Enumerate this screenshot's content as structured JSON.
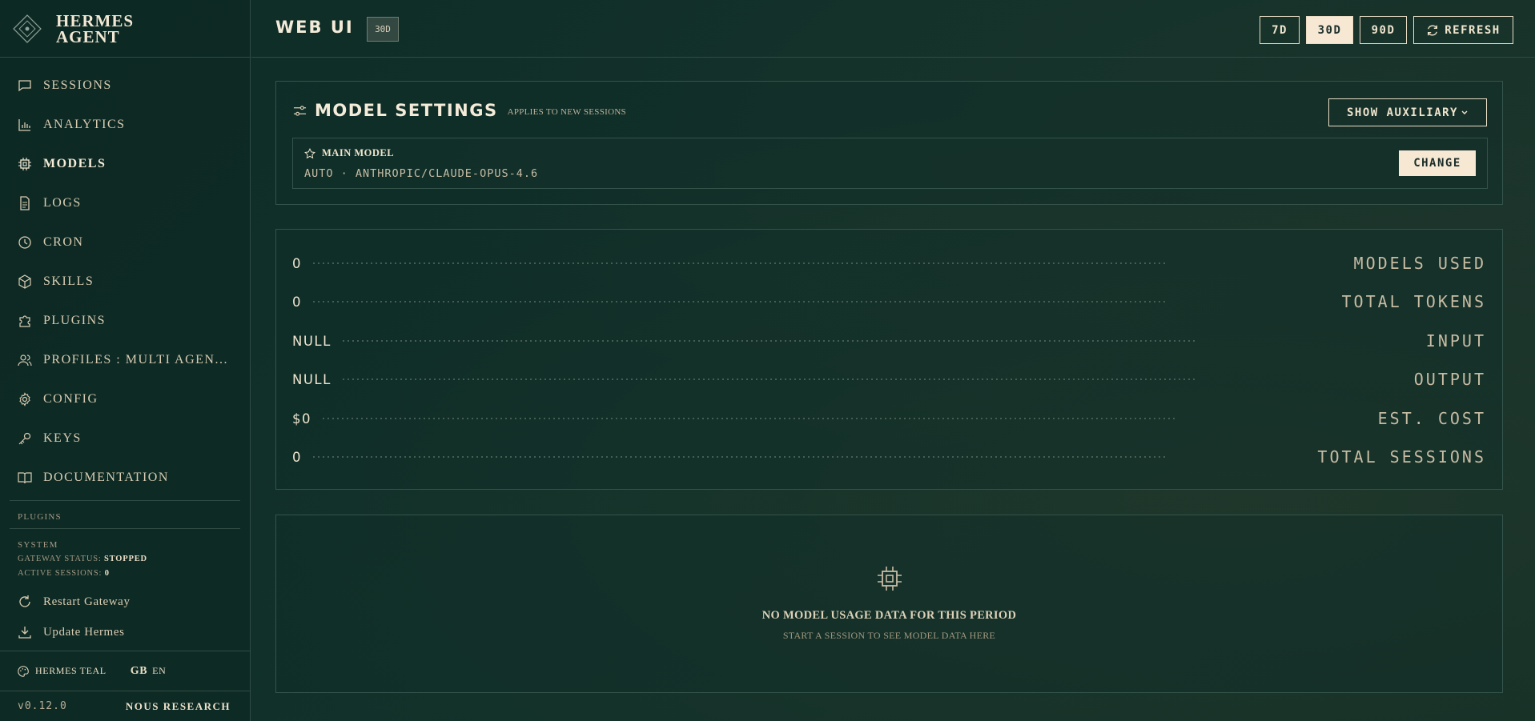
{
  "brand": {
    "line1": "HERMES",
    "line2": "AGENT"
  },
  "sidebar": {
    "items": [
      {
        "label": "SESSIONS",
        "icon": "chat-icon"
      },
      {
        "label": "ANALYTICS",
        "icon": "bar-chart-icon"
      },
      {
        "label": "MODELS",
        "icon": "cpu-icon",
        "active": true
      },
      {
        "label": "LOGS",
        "icon": "file-icon"
      },
      {
        "label": "CRON",
        "icon": "clock-icon"
      },
      {
        "label": "SKILLS",
        "icon": "cube-icon"
      },
      {
        "label": "PLUGINS",
        "icon": "puzzle-icon"
      },
      {
        "label": "PROFILES : MULTI AGEN...",
        "icon": "users-icon"
      },
      {
        "label": "CONFIG",
        "icon": "gear-icon"
      },
      {
        "label": "KEYS",
        "icon": "key-icon"
      },
      {
        "label": "DOCUMENTATION",
        "icon": "book-icon"
      }
    ],
    "plugins_heading": "PLUGINS",
    "system_heading": "SYSTEM",
    "gateway_status_label": "GATEWAY STATUS:",
    "gateway_status_value": "STOPPED",
    "active_sessions_label": "ACTIVE SESSIONS:",
    "active_sessions_value": "0",
    "restart_label": "Restart Gateway",
    "update_label": "Update Hermes",
    "theme_label": "HERMES TEAL",
    "lang_flag": "GB",
    "lang_code": "EN",
    "version": "v0.12.0",
    "vendor": "NOUS RESEARCH"
  },
  "header": {
    "title": "WEB UI",
    "badge": "30D",
    "ranges": [
      {
        "label": "7D",
        "active": false
      },
      {
        "label": "30D",
        "active": true
      },
      {
        "label": "90D",
        "active": false
      }
    ],
    "refresh_label": "REFRESH"
  },
  "model_settings": {
    "title": "MODEL SETTINGS",
    "subtitle": "APPLIES TO NEW SESSIONS",
    "aux_button": "SHOW AUXILIARY",
    "main_model_label": "MAIN MODEL",
    "main_model_value": "AUTO · ANTHROPIC/CLAUDE-OPUS-4.6",
    "change_button": "CHANGE"
  },
  "stats": [
    {
      "value": "0",
      "label": "MODELS USED"
    },
    {
      "value": "0",
      "label": "TOTAL TOKENS"
    },
    {
      "value": "NULL",
      "label": "INPUT"
    },
    {
      "value": "NULL",
      "label": "OUTPUT"
    },
    {
      "value": "$0",
      "label": "EST. COST"
    },
    {
      "value": "0",
      "label": "TOTAL SESSIONS"
    }
  ],
  "empty_state": {
    "title": "NO MODEL USAGE DATA FOR THIS PERIOD",
    "subtitle": "START A SESSION TO SEE MODEL DATA HERE",
    "icon": "cpu-icon"
  },
  "colors": {
    "background": "#0f2b26",
    "accent": "#f7e8d4",
    "text": "#e8dcc4"
  }
}
